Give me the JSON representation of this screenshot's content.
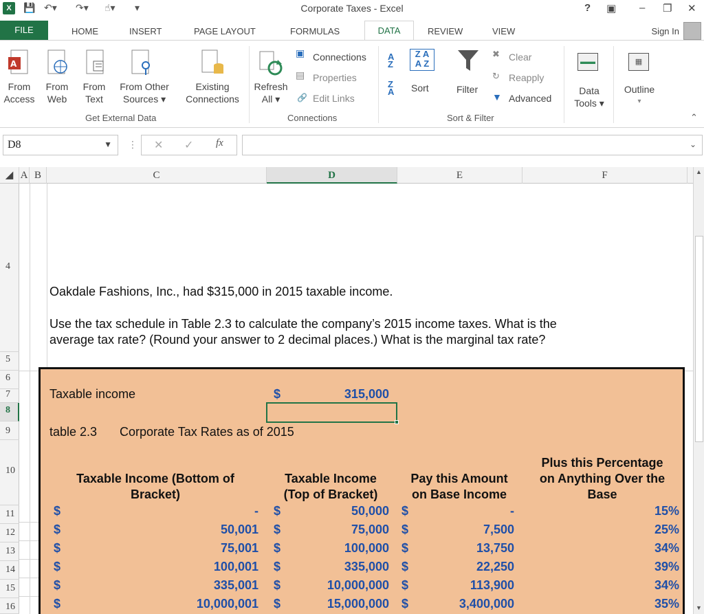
{
  "window": {
    "title": "Corporate Taxes - Excel",
    "help": "?",
    "minimize": "–",
    "close": "✕"
  },
  "tabs": [
    "FILE",
    "HOME",
    "INSERT",
    "PAGE LAYOUT",
    "FORMULAS",
    "DATA",
    "REVIEW",
    "VIEW"
  ],
  "active_tab": "DATA",
  "sign_in": "Sign In",
  "ribbon": {
    "get_external": {
      "group": "Get External Data",
      "from_access": [
        "From",
        "Access"
      ],
      "from_web": [
        "From",
        "Web"
      ],
      "from_text": [
        "From",
        "Text"
      ],
      "from_other": [
        "From Other",
        "Sources ▾"
      ],
      "existing": [
        "Existing",
        "Connections"
      ]
    },
    "connections": {
      "group": "Connections",
      "refresh": [
        "Refresh",
        "All ▾"
      ],
      "connections": "Connections",
      "properties": "Properties",
      "edit_links": "Edit Links"
    },
    "sort_filter": {
      "group": "Sort & Filter",
      "sort": "Sort",
      "filter": "Filter",
      "clear": "Clear",
      "reapply": "Reapply",
      "advanced": "Advanced"
    },
    "data_tools": [
      "Data",
      "Tools ▾"
    ],
    "outline": "Outline"
  },
  "formula_bar": {
    "name_box": "D8",
    "fx": "fx",
    "content": ""
  },
  "columns": [
    "A",
    "B",
    "C",
    "D",
    "E",
    "F"
  ],
  "selected_column": "D",
  "rows": [
    "4",
    "5",
    "6",
    "7",
    "8",
    "9",
    "10",
    "11",
    "12",
    "13",
    "14",
    "15",
    "16"
  ],
  "selected_row": "8",
  "problem": {
    "line1": "Oakdale Fashions, Inc., had $315,000 in 2015 taxable income.",
    "line2": "Use the tax schedule in Table 2.3 to calculate the company’s 2015 income taxes. What is the",
    "line3": "average tax rate? (Round your answer to 2 decimal places.) What is the marginal tax rate?"
  },
  "taxable_income": {
    "label": "Taxable income",
    "dollar": "$",
    "value": "315,000"
  },
  "table_title": {
    "ref": "table 2.3",
    "name": "Corporate Tax Rates as of 2015"
  },
  "table_headers": {
    "bottom": [
      "Taxable Income (Bottom of",
      "Bracket)"
    ],
    "top": [
      "Taxable Income",
      "(Top of Bracket)"
    ],
    "pay": [
      "Pay this Amount",
      "on Base Income"
    ],
    "plus": [
      "Plus this Percentage",
      "on Anything Over the",
      "Base"
    ]
  },
  "table_rows": [
    {
      "bottom": "-",
      "top": "50,000",
      "pay": "-",
      "pct": "15%"
    },
    {
      "bottom": "50,001",
      "top": "75,000",
      "pay": "7,500",
      "pct": "25%"
    },
    {
      "bottom": "75,001",
      "top": "100,000",
      "pay": "13,750",
      "pct": "34%"
    },
    {
      "bottom": "100,001",
      "top": "335,000",
      "pay": "22,250",
      "pct": "39%"
    },
    {
      "bottom": "335,001",
      "top": "10,000,000",
      "pay": "113,900",
      "pct": "34%"
    },
    {
      "bottom": "10,000,001",
      "top": "15,000,000",
      "pay": "3,400,000",
      "pct": "35%"
    }
  ],
  "dollar_sign": "$",
  "colors": {
    "excel_green": "#217346",
    "orange_fill": "#f2c096",
    "value_blue": "#1f4fa8"
  }
}
